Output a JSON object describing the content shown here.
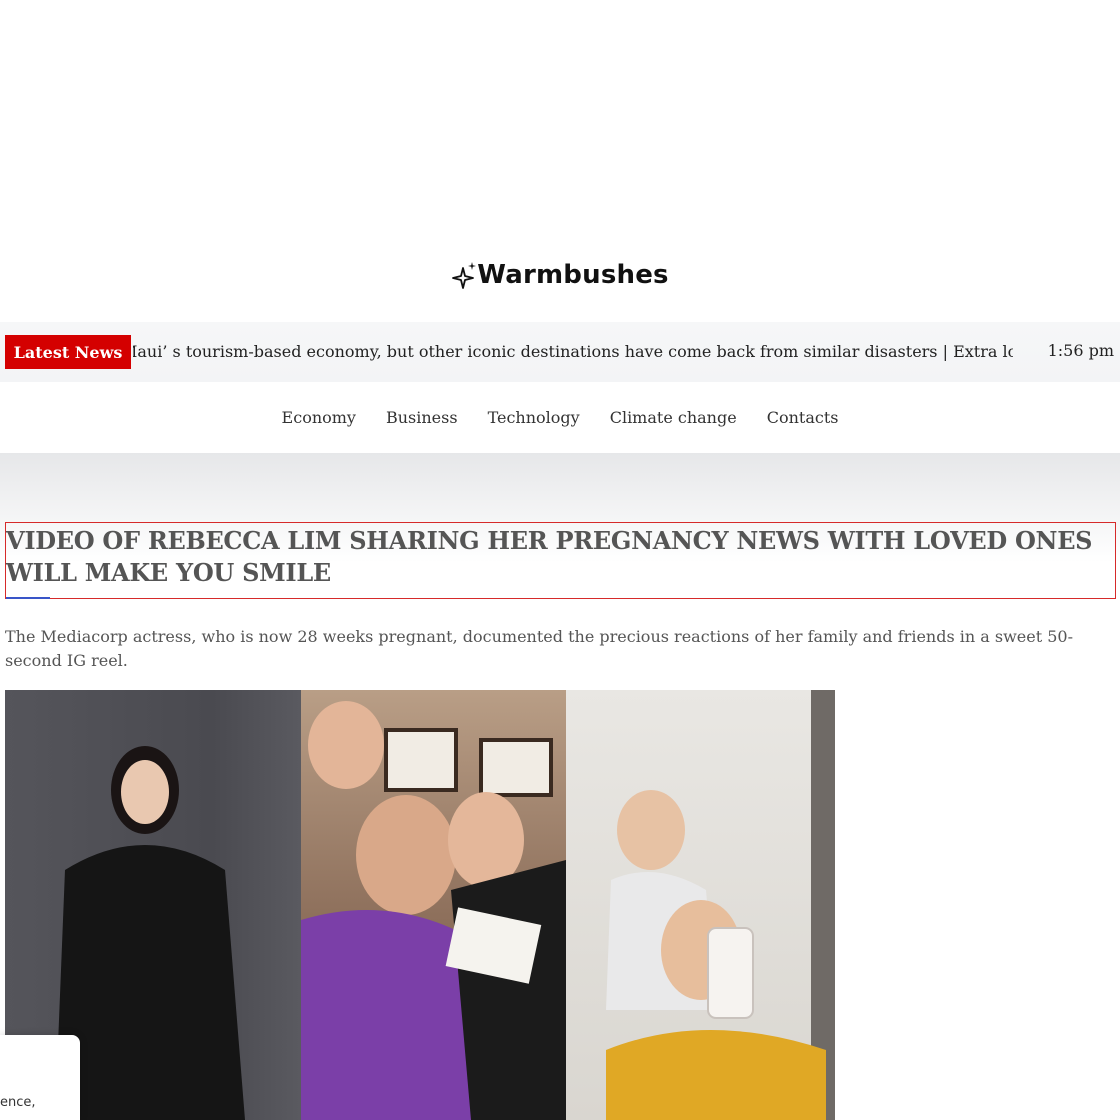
{
  "brand": {
    "name": "Warmbushes",
    "icon": "sparkle-icon"
  },
  "ticker": {
    "label": "Latest News",
    "text": "Maui’ s tourism-based economy, but other iconic destinations have come back from similar disasters  |  Extra logi",
    "time": "1:56 pm"
  },
  "nav": {
    "items": [
      {
        "label": "Economy"
      },
      {
        "label": "Business"
      },
      {
        "label": "Technology"
      },
      {
        "label": "Climate change"
      },
      {
        "label": "Contacts"
      }
    ]
  },
  "article": {
    "headline": "VIDEO OF REBECCA LIM SHARING HER PREGNANCY NEWS WITH LOVED ONES WILL MAKE YOU SMILE",
    "subtitle": "The Mediacorp actress, who is now 28 weeks pregnant, documented the precious reactions of her family and friends in a sweet 50-second IG reel."
  },
  "cookie": {
    "text": "ence,"
  },
  "colors": {
    "accent": "#d40000",
    "headline_border": "#d62a2a",
    "underline": "#3955c8"
  }
}
